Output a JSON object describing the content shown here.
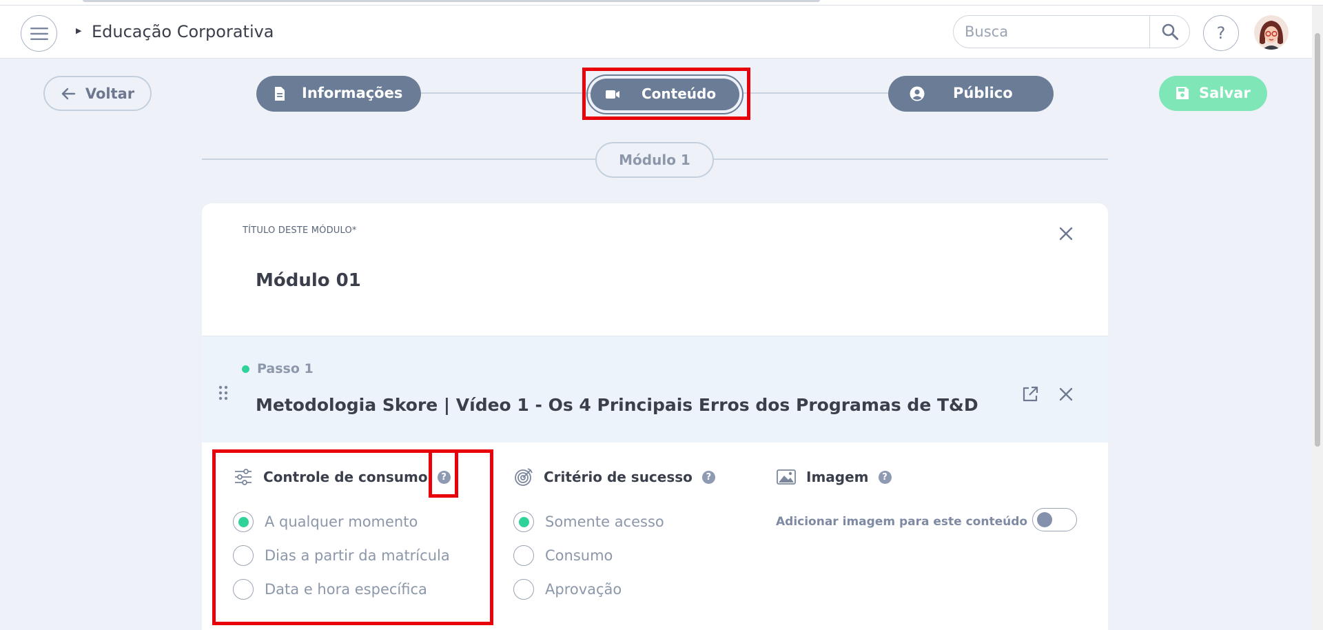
{
  "header": {
    "app_title": "Educação Corporativa",
    "search_placeholder": "Busca",
    "help_label": "?"
  },
  "toolbar": {
    "back_label": "Voltar",
    "save_label": "Salvar",
    "steps": [
      {
        "label": "Informações",
        "icon": "document-icon"
      },
      {
        "label": "Conteúdo",
        "icon": "video-camera-icon",
        "active": true
      },
      {
        "label": "Público",
        "icon": "user-circle-icon"
      }
    ]
  },
  "module": {
    "pill_label": "Módulo 1",
    "title_field_label": "TÍTULO DESTE MÓDULO*",
    "title_value": "Módulo 01"
  },
  "step": {
    "label": "Passo 1",
    "title": "Metodologia Skore | Vídeo 1 - Os 4 Principais Erros dos Programas de T&D"
  },
  "sections": {
    "consumo": {
      "title": "Controle de consumo",
      "icon": "sliders-icon",
      "options": [
        "A qualquer momento",
        "Dias a partir da matrícula",
        "Data e hora específica"
      ],
      "selected": 0
    },
    "sucesso": {
      "title": "Critério de sucesso",
      "icon": "target-icon",
      "options": [
        "Somente acesso",
        "Consumo",
        "Aprovação"
      ],
      "selected": 0
    },
    "imagem": {
      "title": "Imagem",
      "icon": "image-icon",
      "toggle_label": "Adicionar imagem para este conteúdo",
      "toggle_on": false
    }
  },
  "colors": {
    "accent_green": "#2fd39a",
    "step_blue": "#6b7c97",
    "save_green": "#7ee6b7",
    "highlight_red": "#e8000b"
  }
}
